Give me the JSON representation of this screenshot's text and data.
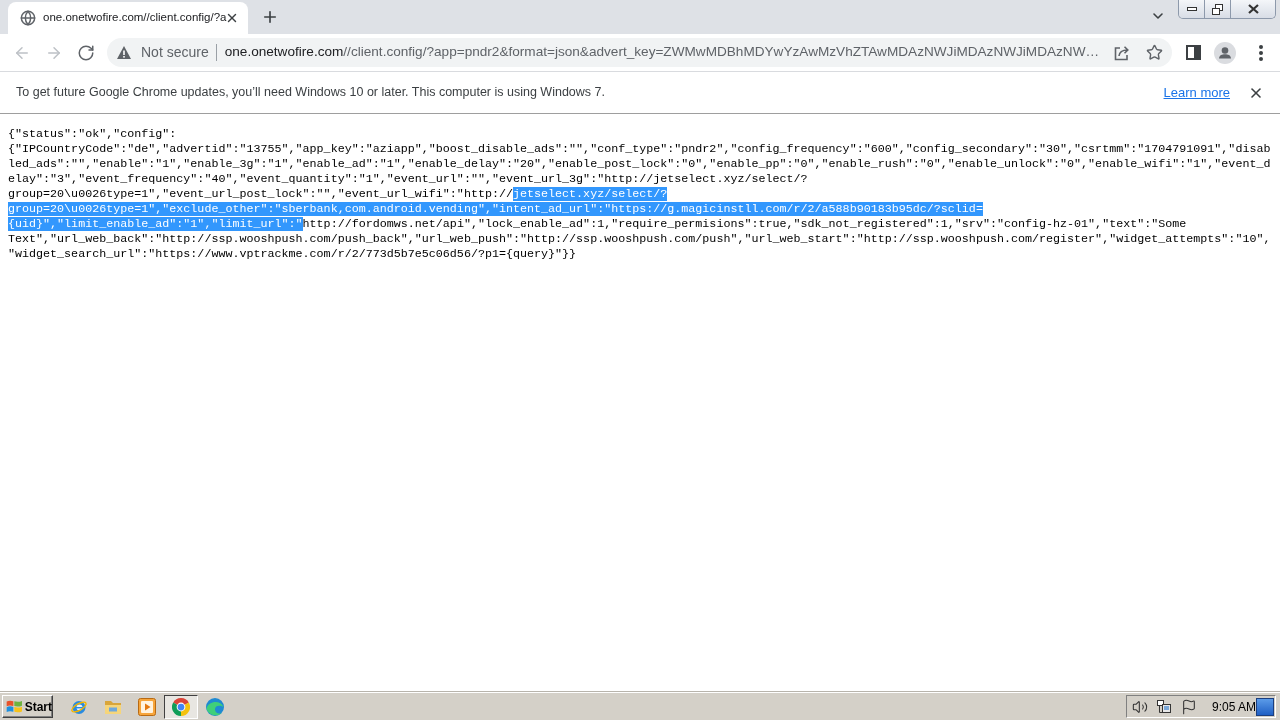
{
  "browser": {
    "tabs": [
      {
        "title": "one.onetwofire.com//client.config/?a",
        "selected": true
      }
    ],
    "nav_buttons": [
      {
        "kind": "back",
        "disabled": true
      },
      {
        "kind": "forward",
        "disabled": true
      },
      {
        "kind": "reload",
        "disabled": false
      }
    ],
    "address_bar": {
      "security": "Not secure",
      "host": "one.onetwofire.com",
      "path": "//client.config/?app=pndr2&format=json&advert_key=ZWMwMDBhMDYwYzAwMzVhZTAwMDAzNWJiMDAzNWJiMDAzNW…"
    }
  },
  "infobar": {
    "message": "To get future Google Chrome updates, you’ll need Windows 10 or later. This computer is using Windows 7.",
    "link": "Learn more"
  },
  "page": {
    "lines": [
      {
        "segments": [
          {
            "text": "{\"status\":\"ok\",\"config\":",
            "selected": false
          }
        ]
      },
      {
        "segments": [
          {
            "text": "{\"IPCountryCode\":\"de\",\"advertid\":\"13755\",\"app_key\":\"aziapp\",\"boost_disable_ads\":\"\",\"conf_type\":\"pndr2\",\"config_frequency\":\"600\",\"config_secondary\":\"30\",\"csrtmm\":\"1704791091\",\"disab",
            "selected": false
          }
        ]
      },
      {
        "segments": [
          {
            "text": "led_ads\":\"\",\"enable\":\"1\",\"enable_3g\":\"1\",\"enable_ad\":\"1\",\"enable_delay\":\"20\",\"enable_post_lock\":\"0\",\"enable_pp\":\"0\",\"enable_rush\":\"0\",\"enable_unlock\":\"0\",\"enable_wifi\":\"1\",\"event_d",
            "selected": false
          }
        ]
      },
      {
        "segments": [
          {
            "text": "elay\":\"3\",\"event_frequency\":\"40\",\"event_quantity\":\"1\",\"event_url\":\"\",\"event_url_3g\":\"http://jetselect.xyz/select/?",
            "selected": false
          }
        ]
      },
      {
        "segments": [
          {
            "text": "group=20\\u0026type=1\",\"event_url_post_lock\":\"\",\"event_url_wifi\":\"http://",
            "selected": false
          },
          {
            "text": "jetselect.xyz/select/?",
            "selected": true
          }
        ]
      },
      {
        "segments": [
          {
            "text": "group=20\\u0026type=1\",\"exclude_other\":\"sberbank,com.android.vending\",\"intent_ad_url\":\"https://g.magicinstll.com/r/2/a588b90183b95dc/?sclid=",
            "selected": true
          }
        ]
      },
      {
        "segments": [
          {
            "text": "{uid}\",\"limit_enable_ad\":\"1\",\"limit_url\":\"",
            "selected": true
          },
          {
            "text": "http://fordomws.net/api\",\"lock_enable_ad\":1,\"require_permisions\":true,\"sdk_not_registered\":1,\"srv\":\"config-hz-01\",\"text\":\"Some",
            "selected": false
          }
        ]
      },
      {
        "segments": [
          {
            "text": "Text\",\"url_web_back\":\"http://ssp.wooshpush.com/push_back\",\"url_web_push\":\"http://ssp.wooshpush.com/push\",\"url_web_start\":\"http://ssp.wooshpush.com/register\",\"widget_attempts\":\"10\",",
            "selected": false
          }
        ]
      },
      {
        "segments": [
          {
            "text": "\"widget_search_url\":\"https://www.vptrackme.com/r/2/773d5b7e5c06d56/?p1={query}\"}}",
            "selected": false
          }
        ]
      }
    ]
  },
  "taskbar": {
    "start": "Start",
    "apps": [
      {
        "kind": "orbit",
        "selected": false
      },
      {
        "kind": "folder",
        "selected": false
      },
      {
        "kind": "media",
        "selected": false
      },
      {
        "kind": "chrome",
        "selected": true
      },
      {
        "kind": "edge",
        "selected": false
      }
    ],
    "clock": "9:05 AM"
  }
}
